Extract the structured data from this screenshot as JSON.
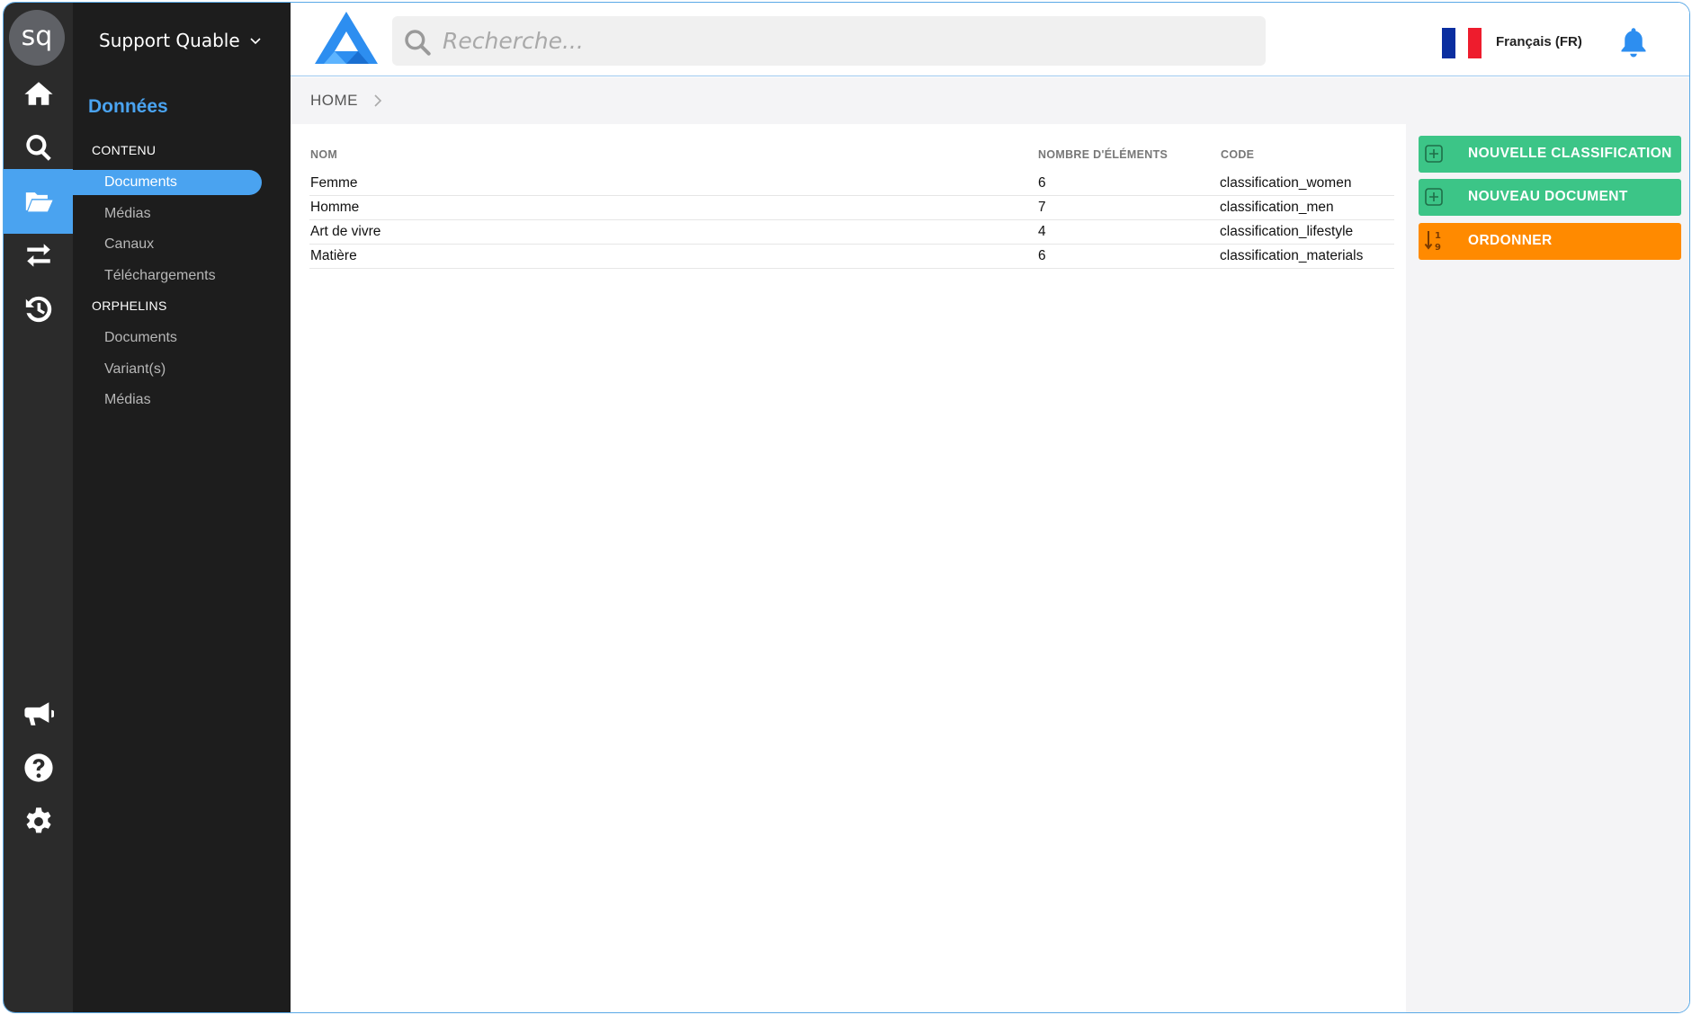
{
  "user": {
    "avatar_initials": "sq"
  },
  "nav": {
    "org_name": "Support Quable",
    "title": "Données",
    "sections": [
      {
        "label": "CONTENU",
        "items": [
          "Documents",
          "Médias",
          "Canaux",
          "Téléchargements"
        ]
      },
      {
        "label": "ORPHELINS",
        "items": [
          "Documents",
          "Variant(s)",
          "Médias"
        ]
      }
    ],
    "active_item": "Documents"
  },
  "topbar": {
    "search_placeholder": "Recherche...",
    "language": "Français (FR)"
  },
  "breadcrumb": {
    "items": [
      "HOME"
    ]
  },
  "table": {
    "headers": [
      "NOM",
      "NOMBRE D'ÉLÉMENTS",
      "CODE"
    ],
    "rows": [
      [
        "Femme",
        "6",
        "classification_women"
      ],
      [
        "Homme",
        "7",
        "classification_men"
      ],
      [
        "Art de vivre",
        "4",
        "classification_lifestyle"
      ],
      [
        "Matière",
        "6",
        "classification_materials"
      ]
    ]
  },
  "actions": {
    "new_classification": "NOUVELLE CLASSIFICATION",
    "new_document": "NOUVEAU DOCUMENT",
    "order": "ORDONNER"
  },
  "colors": {
    "accent": "#4aa3f0",
    "green": "#3cc587",
    "orange": "#ff8a00",
    "sidebar": "#1d1d1d",
    "rail": "#2b2b2b"
  },
  "icons": {
    "rail": [
      "home-icon",
      "search-icon",
      "folder-open-icon",
      "transfer-icon",
      "history-icon",
      "megaphone-icon",
      "help-icon",
      "settings-icon"
    ]
  }
}
